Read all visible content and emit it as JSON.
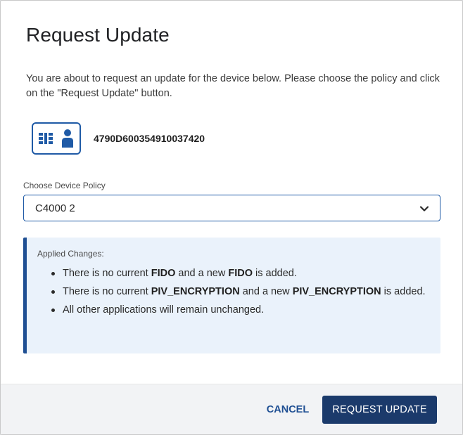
{
  "dialog": {
    "title": "Request Update",
    "intro": "You are about to request an update for the device below. Please choose the policy and click on the \"Request Update\" button."
  },
  "device": {
    "icon": "smartcard-user-icon",
    "id": "4790D600354910037420"
  },
  "policy": {
    "label": "Choose Device Policy",
    "selected": "C4000 2"
  },
  "changes": {
    "title": "Applied Changes:",
    "items": [
      {
        "pre": "There is no current ",
        "b1": "FIDO",
        "mid": " and a new ",
        "b2": "FIDO",
        "post": " is added."
      },
      {
        "pre": "There is no current ",
        "b1": "PIV_ENCRYPTION",
        "mid": " and a new ",
        "b2": "PIV_ENCRYPTION",
        "post": " is added."
      },
      {
        "text": "All other applications will remain unchanged."
      }
    ]
  },
  "actions": {
    "cancel": "CANCEL",
    "request": "REQUEST UPDATE"
  },
  "colors": {
    "accent": "#1f5aa6",
    "primary_button": "#1b3a6b",
    "info_background": "#eaf2fb",
    "info_border": "#1f4f93"
  }
}
